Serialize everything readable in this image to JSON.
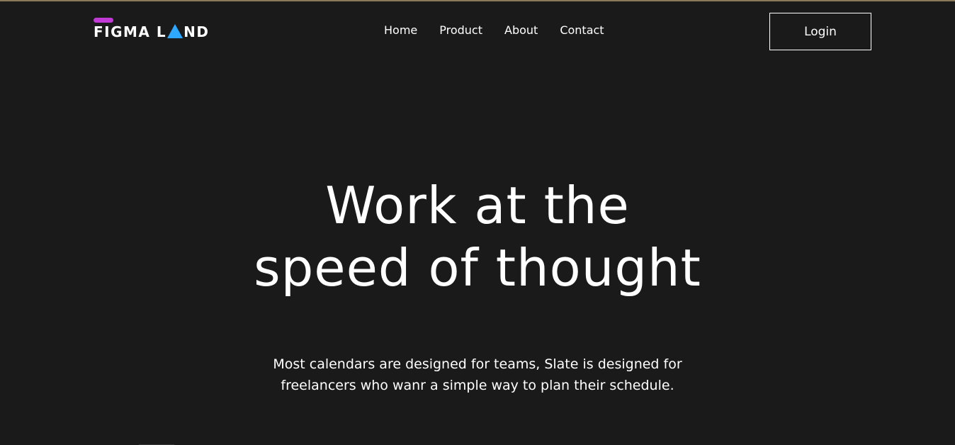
{
  "brand": {
    "name_part1": "FIGMA L",
    "name_part2": "ND",
    "colors": {
      "bar": "#c23ad6",
      "triangle": "#2ea7ff"
    }
  },
  "nav": {
    "items": [
      {
        "label": "Home"
      },
      {
        "label": "Product"
      },
      {
        "label": "About"
      },
      {
        "label": "Contact"
      }
    ],
    "login_label": "Login"
  },
  "hero": {
    "title_line1": "Work at the",
    "title_line2": "speed of thought",
    "subtitle_line1": "Most calendars are designed for teams, Slate is designed for",
    "subtitle_line2": "freelancers who wanr a simple way to plan their schedule."
  },
  "theme": {
    "background": "#1a1a1a",
    "text": "#ffffff"
  }
}
